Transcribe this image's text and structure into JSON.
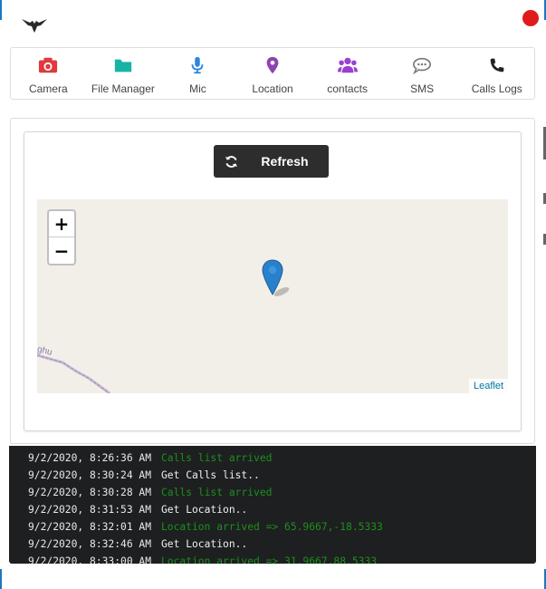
{
  "app": {
    "logo_icon": "bird-logo-icon",
    "status_color": "#e01b1b"
  },
  "nav": {
    "items": [
      {
        "label": "Camera",
        "icon": "camera-icon",
        "color": "#e0393e"
      },
      {
        "label": "File Manager",
        "icon": "folder-icon",
        "color": "#19b3a6"
      },
      {
        "label": "Mic",
        "icon": "microphone-icon",
        "color": "#2e86de"
      },
      {
        "label": "Location",
        "icon": "map-marker-icon",
        "color": "#8e44ad"
      },
      {
        "label": "contacts",
        "icon": "users-icon",
        "color": "#9b3fd1"
      },
      {
        "label": "SMS",
        "icon": "chat-bubble-icon",
        "color": "#777777"
      },
      {
        "label": "Calls Logs",
        "icon": "phone-icon",
        "color": "#222222"
      }
    ]
  },
  "toolbar": {
    "refresh_label": "Refresh",
    "refresh_icon": "refresh-icon"
  },
  "map": {
    "zoom_in": "+",
    "zoom_out": "−",
    "attribution": "Leaflet",
    "road_label": "ghu",
    "marker_icon": "map-pin-icon"
  },
  "console": {
    "log": [
      {
        "time": "9/2/2020, 8:26:36 AM",
        "message": "Calls list arrived",
        "kind": "ok"
      },
      {
        "time": "9/2/2020, 8:30:24 AM",
        "message": "Get Calls list..",
        "kind": "info"
      },
      {
        "time": "9/2/2020, 8:30:28 AM",
        "message": "Calls list arrived",
        "kind": "ok"
      },
      {
        "time": "9/2/2020, 8:31:53 AM",
        "message": "Get Location..",
        "kind": "info"
      },
      {
        "time": "9/2/2020, 8:32:01 AM",
        "message": "Location arrived => 65.9667,-18.5333",
        "kind": "ok"
      },
      {
        "time": "9/2/2020, 8:32:46 AM",
        "message": "Get Location..",
        "kind": "info"
      },
      {
        "time": "9/2/2020, 8:33:00 AM",
        "message": "Location arrived => 31.9667,88.5333",
        "kind": "ok"
      }
    ]
  }
}
